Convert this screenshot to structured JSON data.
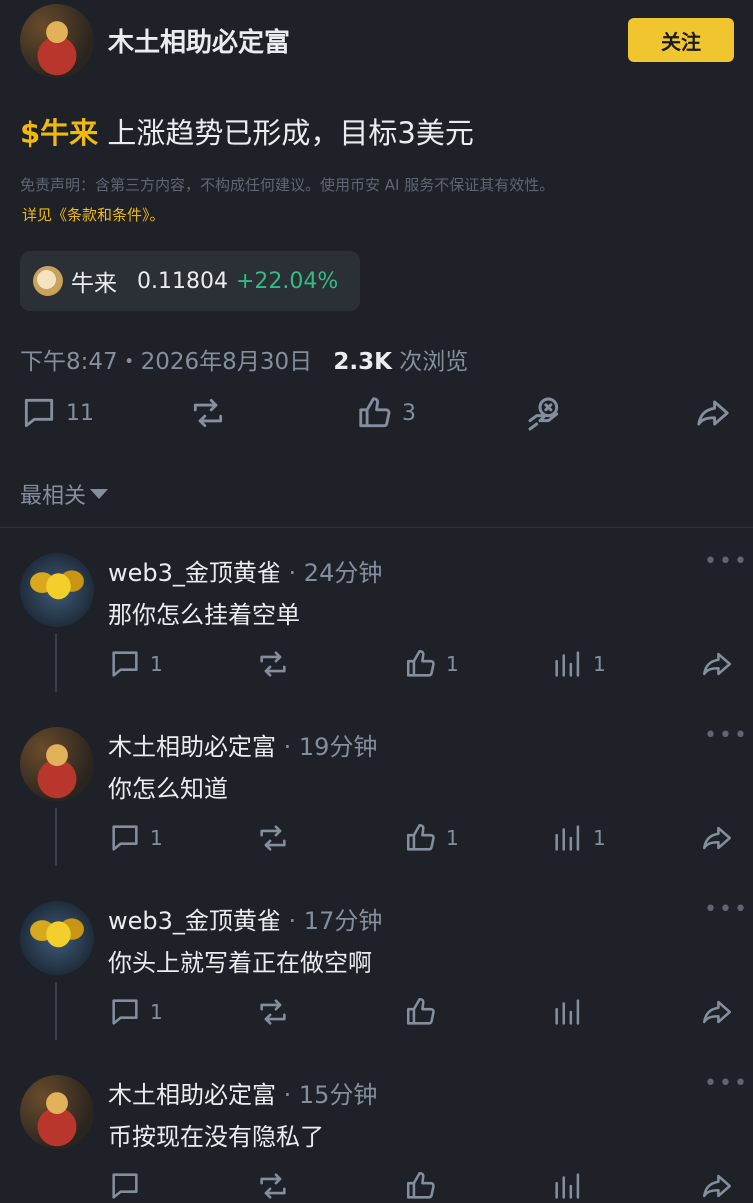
{
  "post": {
    "author": "木土相助必定富",
    "follow_label": "关注",
    "tag": "$牛来",
    "title_text": " 上涨趋势已形成，目标3美元",
    "disclaimer": "免责声明：含第三方内容，不构成任何建议。使用币安 AI 服务不保证其有效性。",
    "terms": "详见《条款和条件》。",
    "coin": {
      "name": "牛来",
      "price": "0.11804",
      "change": "+22.04%"
    },
    "timestamp": "下午8:47・2026年8月30日",
    "views": "2.3K",
    "views_label": "次浏览",
    "actions": {
      "comments": "11",
      "likes": "3"
    }
  },
  "sort": {
    "label": "最相关"
  },
  "comments": [
    {
      "author": "web3_金顶黄雀",
      "time": "· 24分钟",
      "text": "那你怎么挂着空单",
      "replies": "1",
      "likes": "1",
      "views": "1",
      "avatar": "bird"
    },
    {
      "author": "木土相助必定富",
      "time": "· 19分钟",
      "text": "你怎么知道",
      "replies": "1",
      "likes": "1",
      "views": "1",
      "avatar": "deity"
    },
    {
      "author": "web3_金顶黄雀",
      "time": "· 17分钟",
      "text": "你头上就写着正在做空啊",
      "replies": "1",
      "likes": "",
      "views": "",
      "avatar": "bird"
    },
    {
      "author": "木土相助必定富",
      "time": "· 15分钟",
      "text": "币按现在没有隐私了",
      "replies": "",
      "likes": "",
      "views": "",
      "avatar": "deity"
    }
  ],
  "colors": {
    "background": "#1e2128",
    "accent": "#f0b90b",
    "positive": "#2ebd85",
    "muted": "#848e9c"
  }
}
